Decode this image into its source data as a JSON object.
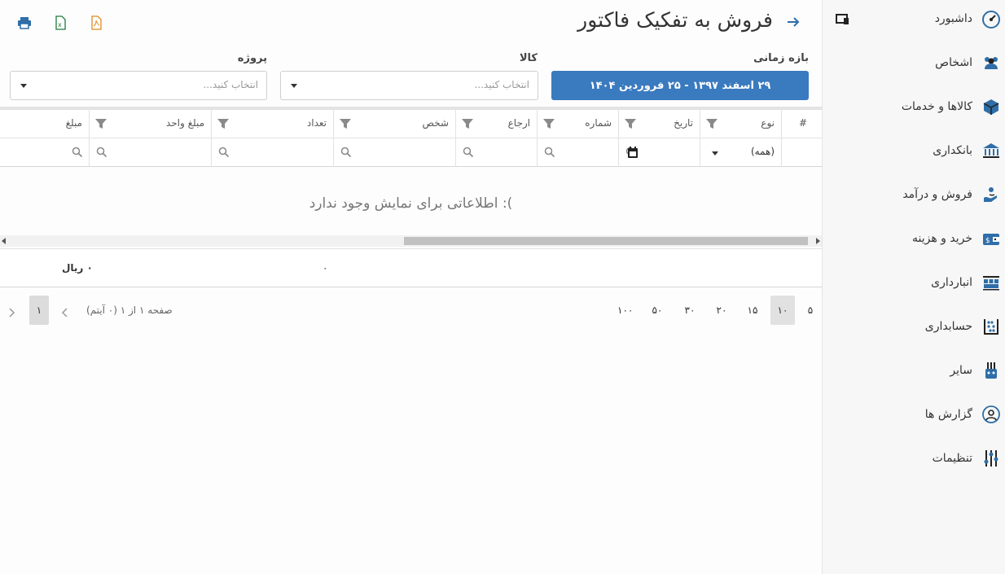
{
  "header": {
    "title": "فروش به تفکیک فاکتور"
  },
  "filters": {
    "period_label": "بازه زمانی",
    "period_value": "۲۹ اسفند ۱۳۹۷ - ۲۵ فروردین ۱۴۰۴",
    "product_label": "کالا",
    "product_placeholder": "انتخاب کنید...",
    "project_label": "پروژه",
    "project_placeholder": "انتخاب کنید..."
  },
  "grid": {
    "columns": [
      "#",
      "نوع",
      "تاریخ",
      "شماره",
      "ارجاع",
      "شخص",
      "تعداد",
      "مبلغ واحد",
      "مبلغ"
    ],
    "type_filter_value": "(همه)",
    "empty_message": "): اطلاعاتی برای نمایش وجود ندارد",
    "summary_amount": "۰ ریال",
    "summary_count": "۰"
  },
  "pager": {
    "sizes": [
      "۵",
      "۱۰",
      "۱۵",
      "۲۰",
      "۳۰",
      "۵۰",
      "۱۰۰"
    ],
    "active_size": "۱۰",
    "info": "صفحه ۱ از ۱ (۰ آیتم)",
    "current_page": "۱"
  },
  "sidebar": {
    "items": [
      {
        "label": "داشبورد",
        "icon": "dashboard-icon"
      },
      {
        "label": "اشخاص",
        "icon": "people-icon"
      },
      {
        "label": "کالاها و خدمات",
        "icon": "box-icon"
      },
      {
        "label": "بانکداری",
        "icon": "bank-icon"
      },
      {
        "label": "فروش و درآمد",
        "icon": "sales-icon"
      },
      {
        "label": "خرید و هزینه",
        "icon": "wallet-icon"
      },
      {
        "label": "انبارداری",
        "icon": "warehouse-icon"
      },
      {
        "label": "حسابداری",
        "icon": "abacus-icon"
      },
      {
        "label": "سایر",
        "icon": "other-icon"
      },
      {
        "label": "گزارش ها",
        "icon": "report-icon"
      },
      {
        "label": "تنظیمات",
        "icon": "settings-icon"
      }
    ]
  },
  "colors": {
    "accent": "#3a7abf",
    "icon_blue": "#2f6ea8",
    "excel_green": "#1e7a3a",
    "pdf_orange": "#e08a1e"
  }
}
